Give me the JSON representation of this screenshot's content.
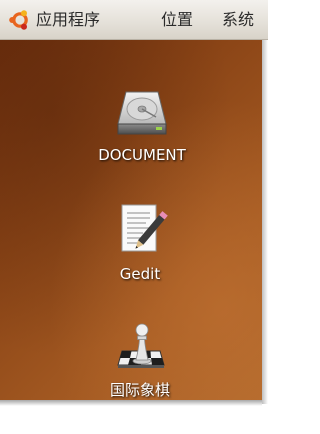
{
  "top_panel": {
    "logo_icon": "ubuntu-logo-icon",
    "menus": [
      {
        "label": "应用程序"
      },
      {
        "label": "位置"
      },
      {
        "label": "系统"
      }
    ]
  },
  "desktop": {
    "icons": [
      {
        "label": "DOCUMENT",
        "icon": "hard-drive-icon"
      },
      {
        "label": "Gedit",
        "icon": "text-editor-icon"
      },
      {
        "label": "国际象棋",
        "icon": "chess-icon"
      }
    ]
  },
  "colors": {
    "panel": "#e4e0d8",
    "desktop": "#8a4416",
    "logo_orange": "#e8641e",
    "logo_red": "#c9281e",
    "logo_yellow": "#f5b21c"
  }
}
